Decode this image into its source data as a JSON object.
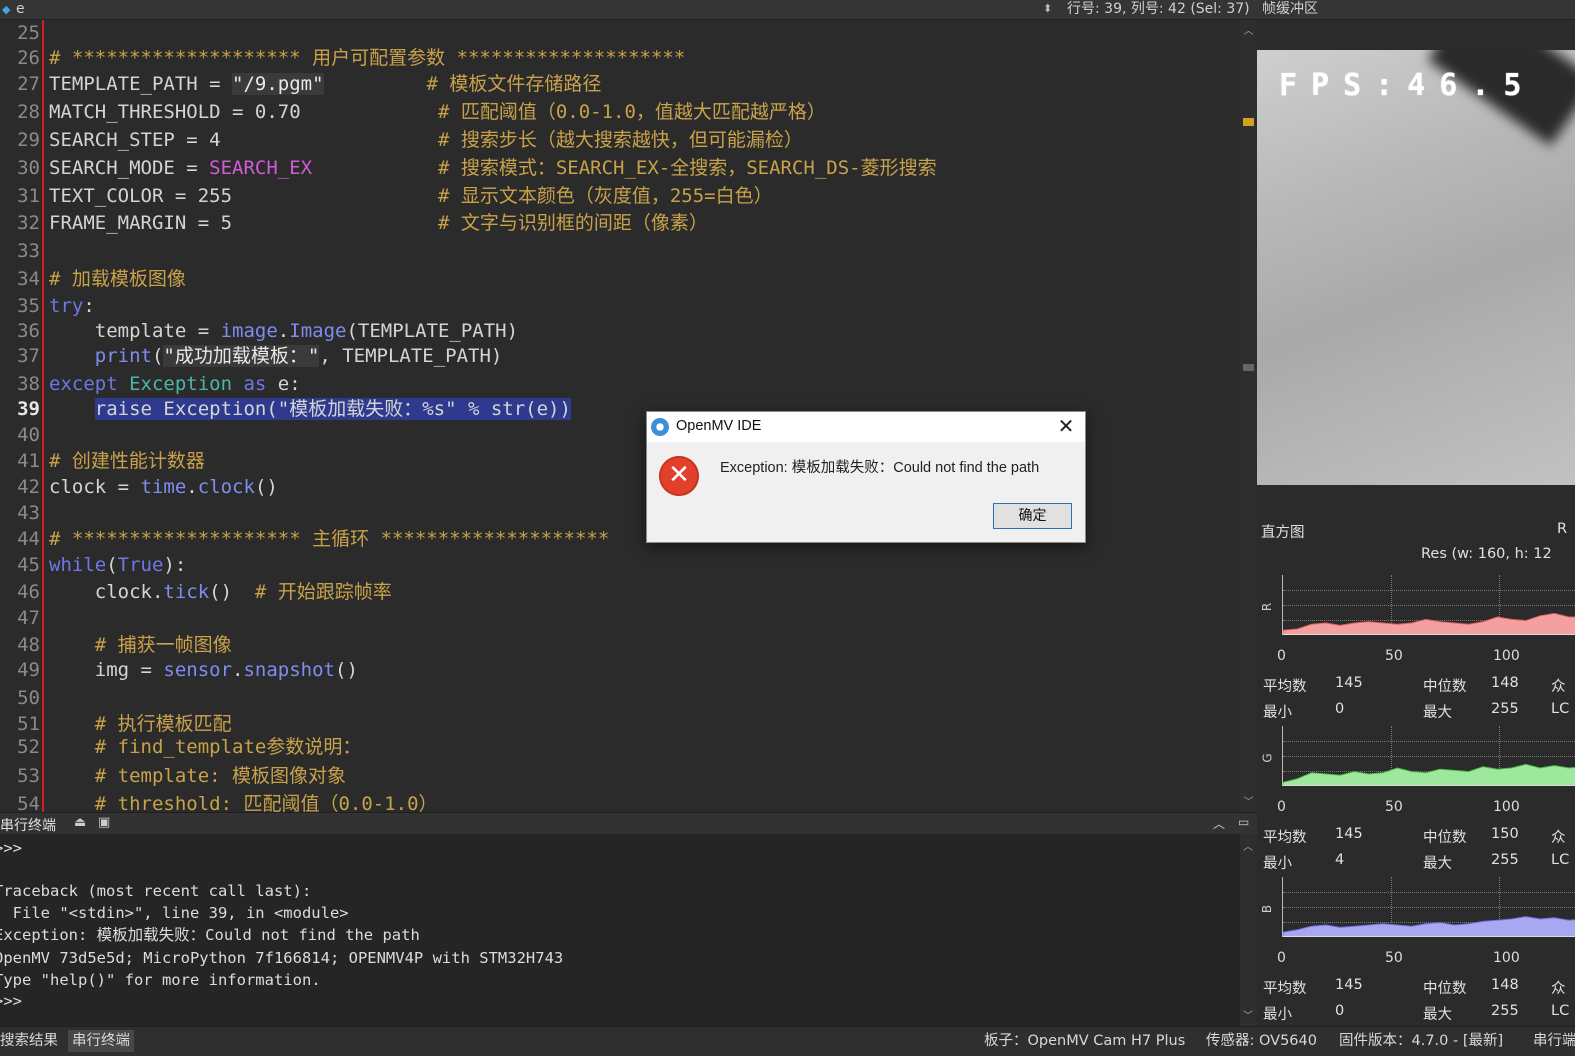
{
  "topbar": {
    "tab_name": "e",
    "cursor_info": "行号: 39, 列号: 42 (Sel: 37)",
    "framebuffer_title": "帧缓冲区"
  },
  "editor": {
    "lines": [
      {
        "n": "25",
        "segs": []
      },
      {
        "n": "26",
        "segs": [
          {
            "t": "# ******************** 用户可配置参数 ********************",
            "c": "c-com"
          }
        ]
      },
      {
        "n": "27",
        "segs": [
          {
            "t": "TEMPLATE_PATH = ",
            "c": ""
          },
          {
            "t": "\"/9.pgm\"",
            "c": "c-str"
          },
          {
            "t": "         ",
            "c": ""
          },
          {
            "t": "# 模板文件存储路径",
            "c": "c-com"
          }
        ]
      },
      {
        "n": "28",
        "segs": [
          {
            "t": "MATCH_THRESHOLD = 0.70            ",
            "c": ""
          },
          {
            "t": "# 匹配阈值（0.0-1.0，值越大匹配越严格）",
            "c": "c-com"
          }
        ]
      },
      {
        "n": "29",
        "segs": [
          {
            "t": "SEARCH_STEP = 4                   ",
            "c": ""
          },
          {
            "t": "# 搜索步长（越大搜索越快，但可能漏检）",
            "c": "c-com"
          }
        ]
      },
      {
        "n": "30",
        "segs": [
          {
            "t": "SEARCH_MODE = ",
            "c": ""
          },
          {
            "t": "SEARCH_EX",
            "c": "c-const"
          },
          {
            "t": "           ",
            "c": ""
          },
          {
            "t": "# 搜索模式：SEARCH_EX-全搜索，SEARCH_DS-菱形搜索",
            "c": "c-com"
          }
        ]
      },
      {
        "n": "31",
        "segs": [
          {
            "t": "TEXT_COLOR = 255                  ",
            "c": ""
          },
          {
            "t": "# 显示文本颜色（灰度值，255=白色）",
            "c": "c-com"
          }
        ]
      },
      {
        "n": "32",
        "segs": [
          {
            "t": "FRAME_MARGIN = 5                  ",
            "c": ""
          },
          {
            "t": "# 文字与识别框的间距（像素）",
            "c": "c-com"
          }
        ]
      },
      {
        "n": "33",
        "segs": []
      },
      {
        "n": "34",
        "segs": [
          {
            "t": "# 加载模板图像",
            "c": "c-com"
          }
        ]
      },
      {
        "n": "35",
        "segs": [
          {
            "t": "try",
            "c": "c-kw"
          },
          {
            "t": ":",
            "c": ""
          }
        ]
      },
      {
        "n": "36",
        "segs": [
          {
            "t": "    template = ",
            "c": ""
          },
          {
            "t": "image",
            "c": "c-fn"
          },
          {
            "t": ".",
            "c": ""
          },
          {
            "t": "Image",
            "c": "c-fn"
          },
          {
            "t": "(TEMPLATE_PATH)",
            "c": ""
          }
        ]
      },
      {
        "n": "37",
        "segs": [
          {
            "t": "    ",
            "c": ""
          },
          {
            "t": "print",
            "c": "c-fn"
          },
          {
            "t": "(",
            "c": ""
          },
          {
            "t": "\"成功加载模板：\"",
            "c": "c-str"
          },
          {
            "t": ", TEMPLATE_PATH)",
            "c": ""
          }
        ]
      },
      {
        "n": "38",
        "segs": [
          {
            "t": "except ",
            "c": "c-kw"
          },
          {
            "t": "Exception",
            "c": "c-exc"
          },
          {
            "t": " as ",
            "c": "c-kw"
          },
          {
            "t": "e:",
            "c": ""
          }
        ]
      },
      {
        "n": "39",
        "segs": [
          {
            "t": "    ",
            "c": ""
          },
          {
            "t": "raise Exception(\"模板加载失败：%s\" % str(e))",
            "c": "sel"
          }
        ],
        "current": true
      },
      {
        "n": "40",
        "segs": []
      },
      {
        "n": "41",
        "segs": [
          {
            "t": "# 创建性能计数器",
            "c": "c-com"
          }
        ]
      },
      {
        "n": "42",
        "segs": [
          {
            "t": "clock = ",
            "c": ""
          },
          {
            "t": "time",
            "c": "c-fn"
          },
          {
            "t": ".",
            "c": ""
          },
          {
            "t": "clock",
            "c": "c-fn"
          },
          {
            "t": "()",
            "c": ""
          }
        ]
      },
      {
        "n": "43",
        "segs": []
      },
      {
        "n": "44",
        "segs": [
          {
            "t": "# ******************** 主循环 ********************",
            "c": "c-com"
          }
        ]
      },
      {
        "n": "45",
        "segs": [
          {
            "t": "while",
            "c": "c-kw"
          },
          {
            "t": "(",
            "c": ""
          },
          {
            "t": "True",
            "c": "c-kw"
          },
          {
            "t": "):",
            "c": ""
          }
        ]
      },
      {
        "n": "46",
        "segs": [
          {
            "t": "    clock.",
            "c": ""
          },
          {
            "t": "tick",
            "c": "c-fn"
          },
          {
            "t": "()  ",
            "c": ""
          },
          {
            "t": "# 开始跟踪帧率",
            "c": "c-com"
          }
        ]
      },
      {
        "n": "47",
        "segs": []
      },
      {
        "n": "48",
        "segs": [
          {
            "t": "    ",
            "c": ""
          },
          {
            "t": "# 捕获一帧图像",
            "c": "c-com"
          }
        ]
      },
      {
        "n": "49",
        "segs": [
          {
            "t": "    img = ",
            "c": ""
          },
          {
            "t": "sensor",
            "c": "c-fn"
          },
          {
            "t": ".",
            "c": ""
          },
          {
            "t": "snapshot",
            "c": "c-fn"
          },
          {
            "t": "()",
            "c": ""
          }
        ]
      },
      {
        "n": "50",
        "segs": []
      },
      {
        "n": "51",
        "segs": [
          {
            "t": "    ",
            "c": ""
          },
          {
            "t": "# 执行模板匹配",
            "c": "c-com"
          }
        ]
      },
      {
        "n": "52",
        "segs": [
          {
            "t": "    ",
            "c": ""
          },
          {
            "t": "# find_template参数说明：",
            "c": "c-com"
          }
        ]
      },
      {
        "n": "53",
        "segs": [
          {
            "t": "    ",
            "c": ""
          },
          {
            "t": "# template: 模板图像对象",
            "c": "c-com"
          }
        ]
      },
      {
        "n": "54",
        "segs": [
          {
            "t": "    ",
            "c": ""
          },
          {
            "t": "# threshold: 匹配阈值（0.0-1.0）",
            "c": "c-com"
          }
        ]
      }
    ]
  },
  "terminal": {
    "title": "串行终端",
    "lines": [
      ">>>",
      "",
      "Traceback (most recent call last):",
      "  File \"<stdin>\", line 39, in <module>",
      "Exception: 模板加载失败：Could not find the path",
      "OpenMV 73d5e5d; MicroPython 7f166814; OPENMV4P with STM32H743",
      "Type \"help()\" for more information.",
      ">>>"
    ]
  },
  "statusbar": {
    "tab_search": "搜索结果",
    "tab_serial": "串行终端",
    "board": "板子：OpenMV Cam H7 Plus",
    "sensor": "传感器: OV5640",
    "firmware": "固件版本：4.7.0 - [最新]",
    "serial_port": "串行端"
  },
  "framebuffer": {
    "fps_text": "FPS:46.5"
  },
  "histogram": {
    "title": "直方图",
    "title_right": "R",
    "res": "Res  (w: 160,  h: 12",
    "channels": [
      {
        "label": "R",
        "color": "#f4a0a0",
        "stroke": "#e06060",
        "values": [
          0.08,
          0.1,
          0.18,
          0.2,
          0.16,
          0.2,
          0.22,
          0.2,
          0.18,
          0.2,
          0.26,
          0.22,
          0.2,
          0.18,
          0.22,
          0.3,
          0.26,
          0.24,
          0.32,
          0.36,
          0.3,
          0.3
        ],
        "stats": {
          "mean_label": "平均数",
          "mean": "145",
          "median_label": "中位数",
          "median": "148",
          "min_label": "最小",
          "min": "0",
          "max_label": "最大",
          "max": "255",
          "mode_label": "众",
          "lq_label": "LC"
        }
      },
      {
        "label": "G",
        "color": "#9ee89e",
        "stroke": "#4cc04c",
        "values": [
          0.06,
          0.12,
          0.22,
          0.2,
          0.18,
          0.24,
          0.2,
          0.22,
          0.3,
          0.24,
          0.22,
          0.28,
          0.26,
          0.24,
          0.32,
          0.28,
          0.3,
          0.36,
          0.3,
          0.34,
          0.3,
          0.32
        ],
        "stats": {
          "mean_label": "平均数",
          "mean": "145",
          "median_label": "中位数",
          "median": "150",
          "min_label": "最小",
          "min": "4",
          "max_label": "最大",
          "max": "255",
          "mode_label": "众",
          "lq_label": "LC"
        }
      },
      {
        "label": "B",
        "color": "#a8a8f0",
        "stroke": "#6f6fe0",
        "values": [
          0.08,
          0.12,
          0.18,
          0.2,
          0.16,
          0.18,
          0.2,
          0.22,
          0.2,
          0.18,
          0.22,
          0.24,
          0.2,
          0.22,
          0.26,
          0.28,
          0.3,
          0.34,
          0.3,
          0.32,
          0.28,
          0.3
        ],
        "stats": {
          "mean_label": "平均数",
          "mean": "145",
          "median_label": "中位数",
          "median": "148",
          "min_label": "最小",
          "min": "0",
          "max_label": "最大",
          "max": "255",
          "mode_label": "众",
          "lq_label": "LC"
        }
      }
    ],
    "ticks": [
      "0",
      "50",
      "100"
    ]
  },
  "dialog": {
    "title": "OpenMV IDE",
    "message": "Exception: 模板加载失败：Could not find the path",
    "ok_label": "确定"
  }
}
